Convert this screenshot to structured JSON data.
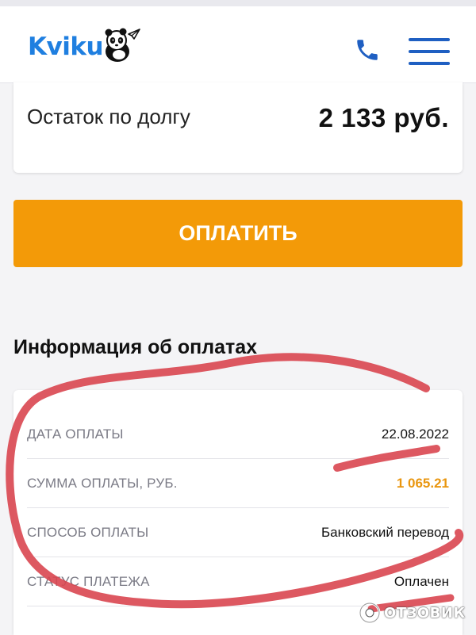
{
  "header": {
    "logo_text": "Kviku",
    "phone_icon": "phone-icon",
    "menu_icon": "hamburger-menu-icon",
    "brand_color": "#1f7fe0"
  },
  "balance": {
    "label": "Остаток по долгу",
    "value": "2 133 руб."
  },
  "pay_button": {
    "label": "ОПЛАТИТЬ",
    "color": "#f39a08"
  },
  "payments_info": {
    "title": "Информация об оплатах",
    "rows": [
      {
        "label": "ДАТА ОПЛАТЫ",
        "value": "22.08.2022"
      },
      {
        "label": "СУММА ОПЛАТЫ, РУБ.",
        "value": "1 065.21"
      },
      {
        "label": "СПОСОБ ОПЛАТЫ",
        "value": "Банковский перевод"
      },
      {
        "label": "СТАТУС ПЛАТЕЖА",
        "value": "Оплачен"
      }
    ]
  },
  "watermark": {
    "text": "ОТЗОВИК"
  }
}
